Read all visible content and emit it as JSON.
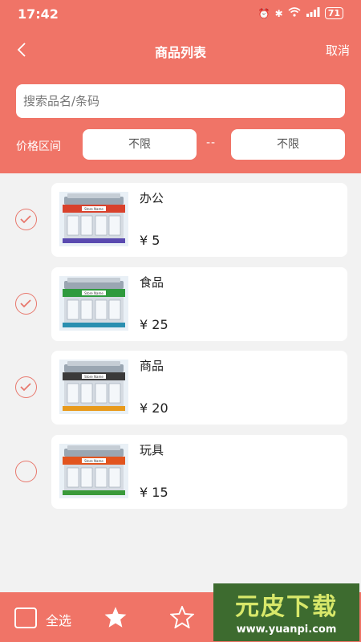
{
  "status_bar": {
    "time": "17:42",
    "battery": "71"
  },
  "nav": {
    "title": "商品列表",
    "cancel_label": "取消"
  },
  "search": {
    "placeholder": "搜索品名/条码",
    "value": ""
  },
  "price_filter": {
    "label": "价格区间",
    "min": "不限",
    "separator": "--",
    "max": "不限"
  },
  "items": [
    {
      "name": "办公",
      "price": "¥ 5",
      "checked": true,
      "accent": "#d9412b",
      "base": "#5a4ab0"
    },
    {
      "name": "食品",
      "price": "¥ 25",
      "checked": true,
      "accent": "#2e9a3d",
      "base": "#2a8fb0"
    },
    {
      "name": "商品",
      "price": "¥ 20",
      "checked": true,
      "accent": "#3a3a3a",
      "base": "#e89a1c"
    },
    {
      "name": "玩具",
      "price": "¥ 15",
      "checked": false,
      "accent": "#e2541e",
      "base": "#3a9a3a"
    }
  ],
  "thumbnail_sign": "Store Name",
  "bottom_bar": {
    "select_all_label": "全选"
  },
  "watermark": {
    "title": "元皮下载",
    "url": "www.yuanpi.com"
  },
  "colors": {
    "primary": "#f07467",
    "check": "#e8786d"
  }
}
